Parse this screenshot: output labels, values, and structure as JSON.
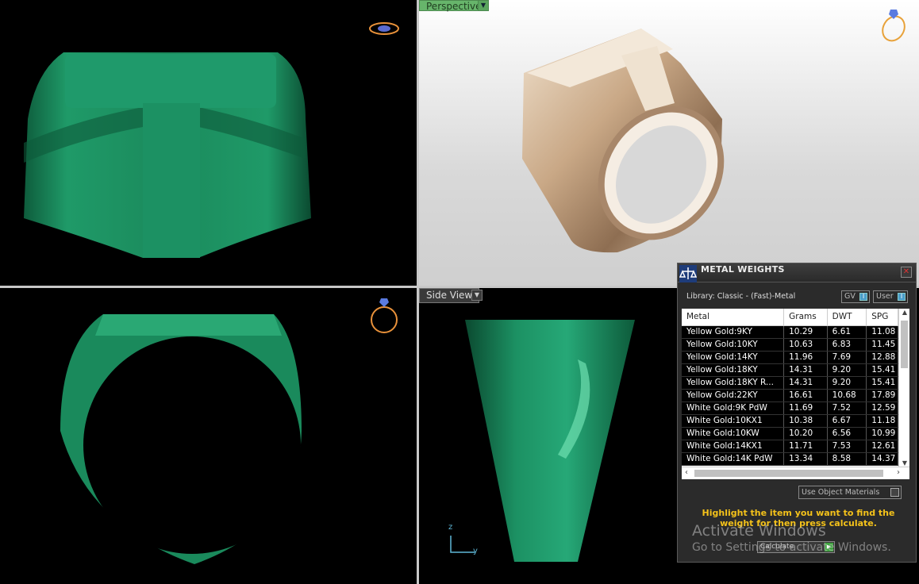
{
  "viewports": {
    "perspective_label": "Perspective",
    "side_label": "Side View",
    "axis_z": "z",
    "axis_y": "y"
  },
  "metal_weights": {
    "title": "METAL WEIGHTS",
    "library": "Library: Classic - (Fast)-Metal",
    "toggle_gv": "GV",
    "toggle_user": "User",
    "columns": [
      "Metal",
      "Grams",
      "DWT",
      "SPG"
    ],
    "rows": [
      [
        "Yellow Gold:9KY",
        "10.29",
        "6.61",
        "11.08"
      ],
      [
        "Yellow Gold:10KY",
        "10.63",
        "6.83",
        "11.45"
      ],
      [
        "Yellow Gold:14KY",
        "11.96",
        "7.69",
        "12.88"
      ],
      [
        "Yellow Gold:18KY",
        "14.31",
        "9.20",
        "15.41"
      ],
      [
        "Yellow Gold:18KY R...",
        "14.31",
        "9.20",
        "15.41"
      ],
      [
        "Yellow Gold:22KY",
        "16.61",
        "10.68",
        "17.89"
      ],
      [
        "White Gold:9K PdW",
        "11.69",
        "7.52",
        "12.59"
      ],
      [
        "White Gold:10KX1",
        "10.38",
        "6.67",
        "11.18"
      ],
      [
        "White Gold:10KW",
        "10.20",
        "6.56",
        "10.99"
      ],
      [
        "White Gold:14KX1",
        "11.71",
        "7.53",
        "12.61"
      ],
      [
        "White Gold:14K PdW",
        "13.34",
        "8.58",
        "14.37"
      ]
    ],
    "use_object_materials": "Use Object Materials",
    "hint": "Highlight the item you want to find the weight for then press calculate.",
    "calculate": "Calculate"
  },
  "watermark": {
    "line1": "Activate Windows",
    "line2": "Go to Settings to activate Windows."
  },
  "colors": {
    "ring_green": "#1f8a5e",
    "ring_gold": "#c9a886",
    "viewport_label_green": "#67b56b",
    "hint_yellow": "#f4c21a"
  }
}
